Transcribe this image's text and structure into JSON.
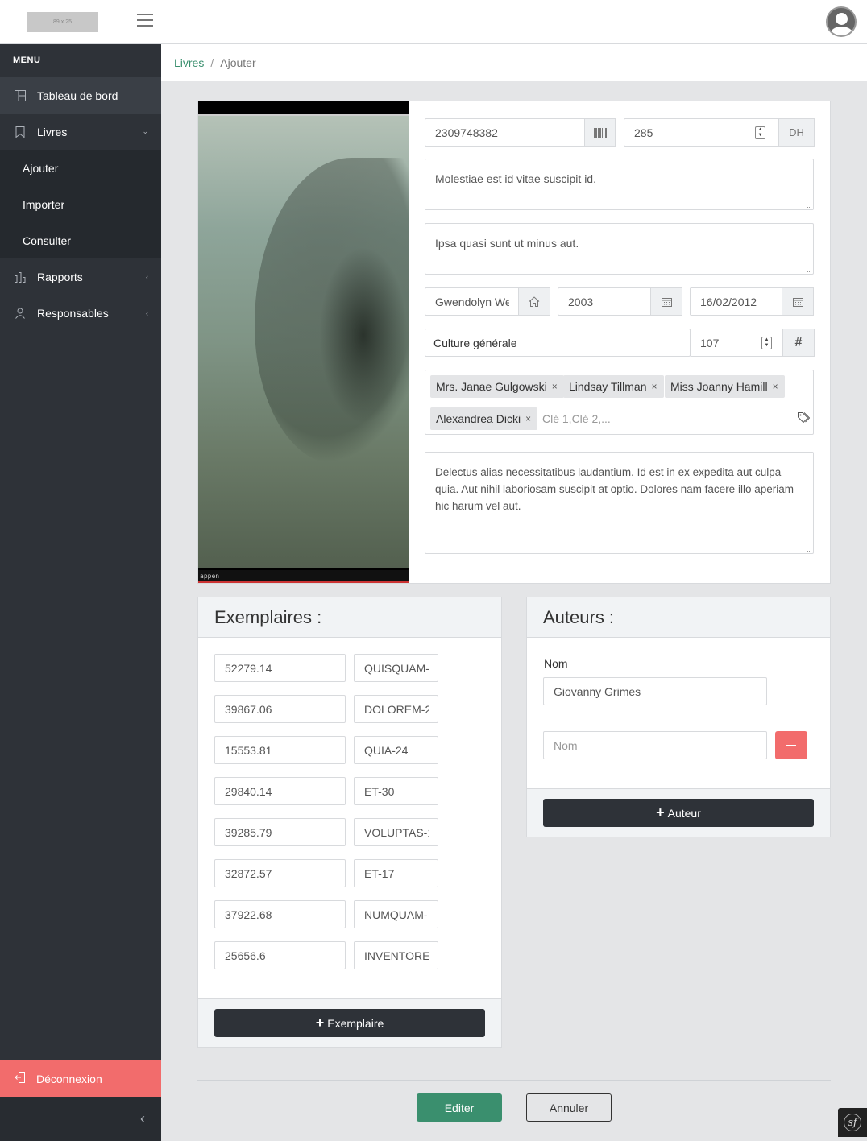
{
  "header": {
    "logo_text": "89 x 25"
  },
  "sidebar": {
    "menu_title": "MENU",
    "items": {
      "dashboard": "Tableau de bord",
      "books": "Livres",
      "reports": "Rapports",
      "managers": "Responsables"
    },
    "books_sub": {
      "add": "Ajouter",
      "import": "Importer",
      "browse": "Consulter"
    },
    "logout": "Déconnexion"
  },
  "breadcrumb": {
    "parent": "Livres",
    "separator": "/",
    "current": "Ajouter"
  },
  "book": {
    "cover_caption": "appen",
    "isbn": "2309748382",
    "price": "285",
    "currency": "DH",
    "title": "Molestiae est id vitae suscipit id.",
    "subtitle": "Ipsa quasi sunt ut minus aut.",
    "publisher": "Gwendolyn We",
    "year": "2003",
    "date": "16/02/2012",
    "category": "Culture générale",
    "pages": "107",
    "keywords": [
      "Mrs. Janae Gulgowski",
      "Lindsay Tillman",
      "Miss Joanny Hamill",
      "Alexandrea Dicki"
    ],
    "keywords_placeholder": "Clé 1,Clé 2,...",
    "description": "Delectus alias necessitatibus laudantium. Id est in ex expedita aut culpa quia. Aut nihil laboriosam suscipit at optio. Dolores nam facere illo aperiam hic harum vel aut."
  },
  "copies": {
    "title": "Exemplaires :",
    "rows": [
      {
        "price": "52279.14",
        "code": "QUISQUAM-"
      },
      {
        "price": "39867.06",
        "code": "DOLOREM-2"
      },
      {
        "price": "15553.81",
        "code": "QUIA-24"
      },
      {
        "price": "29840.14",
        "code": "ET-30"
      },
      {
        "price": "39285.79",
        "code": "VOLUPTAS-1"
      },
      {
        "price": "32872.57",
        "code": "ET-17"
      },
      {
        "price": "37922.68",
        "code": "NUMQUAM-"
      },
      {
        "price": "25656.6",
        "code": "INVENTORE-"
      }
    ],
    "add_label": "Exemplaire"
  },
  "authors": {
    "title": "Auteurs :",
    "name_label": "Nom",
    "name_value": "Giovanny Grimes",
    "name_placeholder": "Nom",
    "add_label": "Auteur"
  },
  "actions": {
    "submit": "Editer",
    "cancel": "Annuler"
  },
  "colors": {
    "accent": "#3a8f6e",
    "danger": "#f26c6c",
    "sidebar": "#2e3238"
  }
}
